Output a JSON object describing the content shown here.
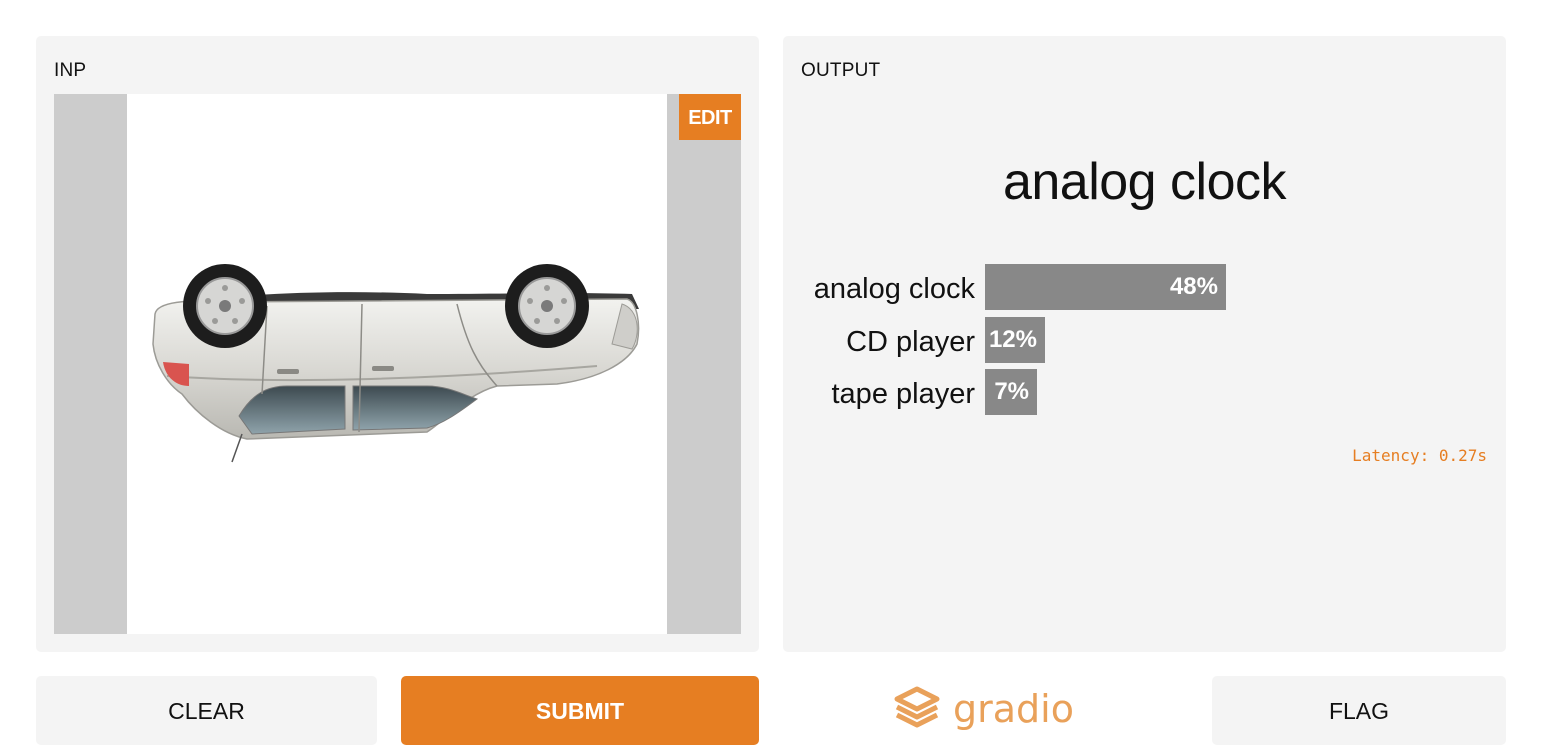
{
  "input_panel": {
    "title": "INP",
    "edit_label": "EDIT",
    "image": {
      "subject": "car",
      "orientation": "upside down"
    }
  },
  "output_panel": {
    "title": "OUTPUT",
    "top_label": "analog clock",
    "confidences": [
      {
        "label": "analog clock",
        "value": "48%",
        "fraction": 0.48
      },
      {
        "label": "CD player",
        "value": "12%",
        "fraction": 0.12
      },
      {
        "label": "tape player",
        "value": "7%",
        "fraction": 0.07
      }
    ],
    "latency": "Latency: 0.27s"
  },
  "actions": {
    "clear_label": "CLEAR",
    "submit_label": "SUBMIT",
    "flag_label": "FLAG"
  },
  "brand": {
    "name": "gradio",
    "icon": "gradio-logo-icon"
  },
  "colors": {
    "accent": "#e67e22",
    "panel_bg": "#f4f4f4",
    "bar": "#888888",
    "image_padding": "#cccccc"
  }
}
